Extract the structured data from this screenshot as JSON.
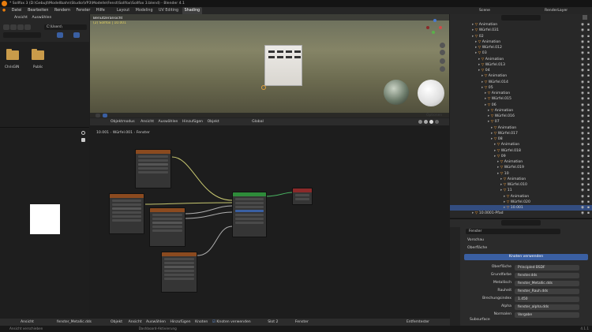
{
  "titlebar": {
    "title": "* Sollfox 3 (D:\\Gebujt\\Modellbahn\\Studio\\VP3\\Modelle\\Fenst\\Sollfox\\Sollfox 3.blend) - Blender 4.1"
  },
  "menu": {
    "items": [
      "Datei",
      "Bearbeiten",
      "Rendern",
      "Fenster",
      "Hilfe"
    ]
  },
  "workspaces": {
    "tabs": [
      "Layout",
      "Modeling",
      "UV Editing",
      "Shading"
    ],
    "active": "Shading"
  },
  "filebrowser": {
    "header": [
      "Ansicht",
      "Auswählen"
    ],
    "path": "C:\\Users\\",
    "folders": [
      {
        "name": "ChrisGIN"
      },
      {
        "name": "Public"
      }
    ]
  },
  "viewport": {
    "view_name": "Benutzeransicht",
    "object_info": "(2) Sollfox | 10.001",
    "header_items": [
      "Objektmodus",
      "Ansicht",
      "Auswählen",
      "Hinzufügen",
      "Objekt"
    ],
    "transform": "Global",
    "options_label": "Optionen"
  },
  "node_editor": {
    "breadcrumb": [
      "10.001",
      "Würfel.001",
      "Fenster"
    ],
    "header_items": [
      "Objekt",
      "Ansicht",
      "Auswählen",
      "Hinzufügen",
      "Knoten"
    ],
    "use_nodes_label": "Knoten verwenden",
    "slot": "Slot 2",
    "material": "Fenster",
    "image_name": "fenster_Metallic.dds",
    "image_header": [
      "Ansicht"
    ]
  },
  "outliner": {
    "search_placeholder": "",
    "scene": "Scene",
    "renderlayer": "RenderLayer",
    "rows": [
      {
        "label": "Animation",
        "indent": 0
      },
      {
        "label": "Würfel.031",
        "indent": 0
      },
      {
        "label": "02",
        "indent": 0
      },
      {
        "label": "Animation",
        "indent": 1
      },
      {
        "label": "Würfel.012",
        "indent": 1
      },
      {
        "label": "03",
        "indent": 1
      },
      {
        "label": "Animation",
        "indent": 2
      },
      {
        "label": "Würfel.013",
        "indent": 2
      },
      {
        "label": "04",
        "indent": 2
      },
      {
        "label": "Animation",
        "indent": 3
      },
      {
        "label": "Würfel.014",
        "indent": 3
      },
      {
        "label": "05",
        "indent": 3
      },
      {
        "label": "Animation",
        "indent": 4
      },
      {
        "label": "Würfel.015",
        "indent": 4
      },
      {
        "label": "06",
        "indent": 4
      },
      {
        "label": "Animation",
        "indent": 5
      },
      {
        "label": "Würfel.016",
        "indent": 5
      },
      {
        "label": "07",
        "indent": 5
      },
      {
        "label": "Animation",
        "indent": 6
      },
      {
        "label": "Würfel.017",
        "indent": 6
      },
      {
        "label": "08",
        "indent": 6
      },
      {
        "label": "Animation",
        "indent": 7
      },
      {
        "label": "Würfel.018",
        "indent": 7
      },
      {
        "label": "09",
        "indent": 7
      },
      {
        "label": "Animation",
        "indent": 8
      },
      {
        "label": "Würfel.019",
        "indent": 8
      },
      {
        "label": "10",
        "indent": 8
      },
      {
        "label": "Animation",
        "indent": 9
      },
      {
        "label": "Würfel.010",
        "indent": 9
      },
      {
        "label": "11",
        "indent": 9
      },
      {
        "label": "Animation",
        "indent": 10
      },
      {
        "label": "Würfel.020",
        "indent": 10
      },
      {
        "label": "10.001",
        "indent": 10,
        "selected": true
      },
      {
        "label": "10.0001-Pfad",
        "indent": 0
      }
    ]
  },
  "properties": {
    "material_name": "Fenster",
    "sections": [
      "Vorschau",
      "Oberfläche"
    ],
    "use_nodes_button": "Knoten verwenden",
    "rows": [
      {
        "label": "Oberfläche",
        "value": "Principled BSDF"
      },
      {
        "label": "Grundfarbe",
        "value": "fenster.dds"
      },
      {
        "label": "Metallisch",
        "value": "fenster_Metallic.dds"
      },
      {
        "label": "Rauheit",
        "value": "fenster_Rauh.dds"
      },
      {
        "label": "Brechungsindex",
        "value": "1.450"
      },
      {
        "label": "Alpha",
        "value": "fenster_alpha.dds"
      },
      {
        "label": "Normalen",
        "value": "Vorgabe"
      }
    ],
    "subsurface": "Subsurface"
  },
  "bottombar": {
    "entity": "Entferntester"
  },
  "status": {
    "left": "Ansicht verschieben",
    "middle": "Dashboard-Aktivierung",
    "version": "4.1.1"
  },
  "colors": {
    "accent": "#3a5fa2",
    "selection": "#334d80",
    "node_header_image": "#8b4a1f",
    "node_header_shader": "#2e8b3a",
    "node_header_output": "#8b2a2a",
    "link": "#c8c870"
  }
}
